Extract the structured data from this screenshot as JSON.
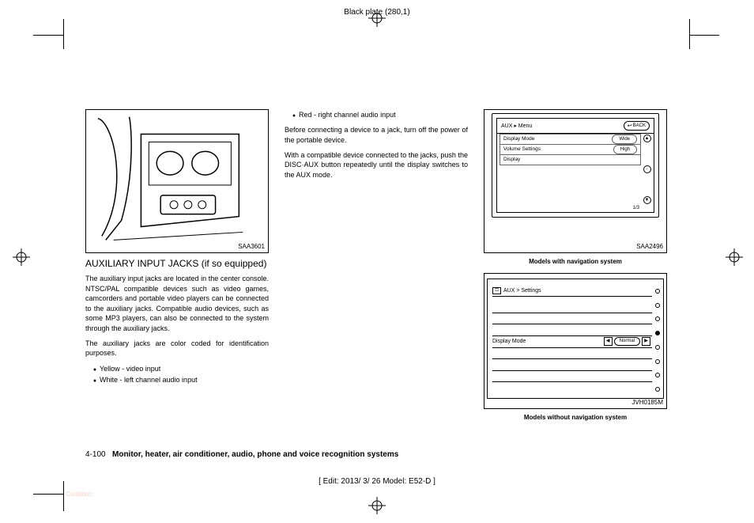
{
  "meta": {
    "plate_top": "Black plate (280,1)",
    "edit_line": "[ Edit: 2013/ 3/ 26  Model: E52-D ]",
    "condition": "Condition:"
  },
  "footer": {
    "page_num": "4-100",
    "title": "Monitor, heater, air conditioner, audio, phone and voice recognition systems"
  },
  "left": {
    "fig_code": "SAA3601",
    "heading": "AUXILIARY INPUT JACKS (if so equipped)",
    "p1": "The auxiliary input jacks are located in the center console. NTSC/PAL compatible devices such as video games, camcorders and portable video players can be connected to the auxiliary jacks. Compatible audio devices, such as some MP3 players, can also be connected to the system through the auxiliary jacks.",
    "p2": "The auxiliary jacks are color coded for identification purposes.",
    "bullets": {
      "b1": "Yellow - video input",
      "b2": "White - left channel audio input"
    }
  },
  "mid": {
    "bullets": {
      "b1": "Red - right channel audio input"
    },
    "p1": "Before connecting a device to a jack, turn off the power of the portable device.",
    "p2": "With a compatible device connected to the jacks, push the DISC·AUX button repeatedly until the display switches to the AUX mode."
  },
  "right": {
    "fig1": {
      "code": "SAA2496",
      "caption": "Models with navigation system",
      "header_left": "AUX ▸ Menu",
      "back": "BACK",
      "row1_label": "Display Mode",
      "row1_value": "Wide",
      "row2_label": "Volume Settings",
      "row2_value": "High",
      "row3_label": "Display",
      "page": "1/3"
    },
    "fig2": {
      "code": "JVH0185M",
      "caption": "Models without navigation system",
      "header": "AUX > Settings",
      "row_label": "Display Mode",
      "row_value": "Normal"
    }
  }
}
